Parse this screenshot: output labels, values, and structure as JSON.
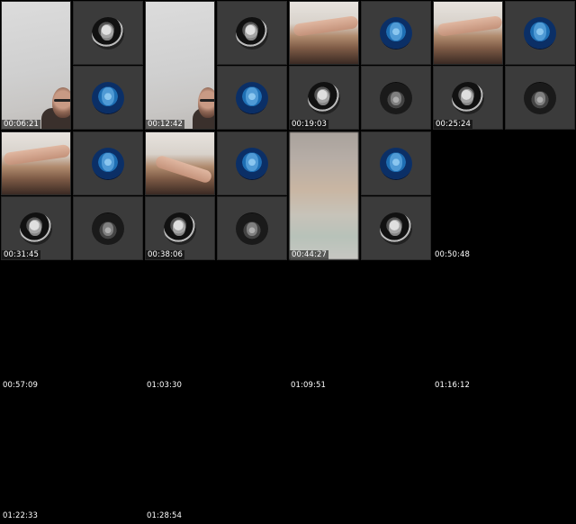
{
  "contact_sheet": {
    "frames": [
      {
        "timestamp": "00:06:21"
      },
      {
        "timestamp": "00:12:42"
      },
      {
        "timestamp": "00:19:03"
      },
      {
        "timestamp": "00:25:24"
      },
      {
        "timestamp": "00:31:45"
      },
      {
        "timestamp": "00:38:06"
      },
      {
        "timestamp": "00:44:27"
      },
      {
        "timestamp": "00:50:48"
      },
      {
        "timestamp": "00:57:09"
      },
      {
        "timestamp": "01:03:30"
      },
      {
        "timestamp": "01:09:51"
      },
      {
        "timestamp": "01:16:12"
      },
      {
        "timestamp": "01:22:33"
      },
      {
        "timestamp": "01:28:54"
      }
    ],
    "background_color": "#000000",
    "tile_color": "#3b3b3b"
  }
}
